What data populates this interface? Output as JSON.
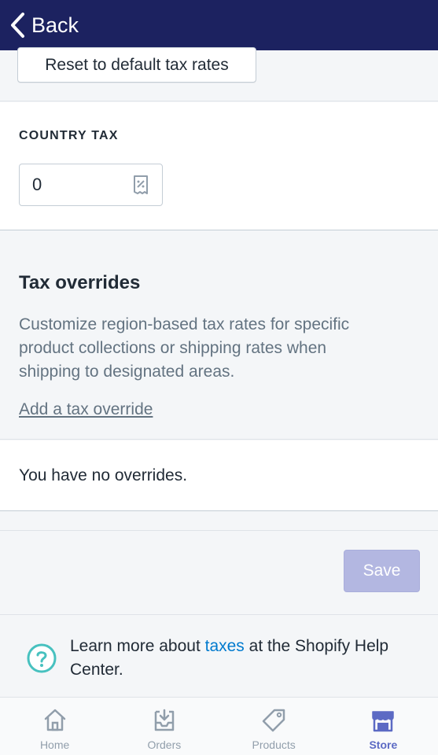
{
  "header": {
    "back_label": "Back"
  },
  "reset": {
    "button_label": "Reset to default tax rates"
  },
  "country_tax": {
    "heading": "COUNTRY TAX",
    "value": "0"
  },
  "overrides": {
    "title": "Tax overrides",
    "description": "Customize region-based tax rates for specific product collections or shipping rates when shipping to designated areas.",
    "add_link": "Add a tax override",
    "empty_text": "You have no overrides."
  },
  "actions": {
    "save_label": "Save"
  },
  "help": {
    "prefix": "Learn more about ",
    "link": "taxes",
    "suffix": " at the Shopify Help Center."
  },
  "tabbar": {
    "items": [
      {
        "label": "Home",
        "icon": "home-icon"
      },
      {
        "label": "Orders",
        "icon": "orders-icon"
      },
      {
        "label": "Products",
        "icon": "tag-icon"
      },
      {
        "label": "Store",
        "icon": "store-icon"
      }
    ],
    "active": "Store"
  },
  "colors": {
    "topbar": "#1c2260",
    "accent": "#5c6ac4",
    "save_disabled": "#b3b7e1",
    "link": "#007ace",
    "help_icon": "#47c1bf"
  }
}
